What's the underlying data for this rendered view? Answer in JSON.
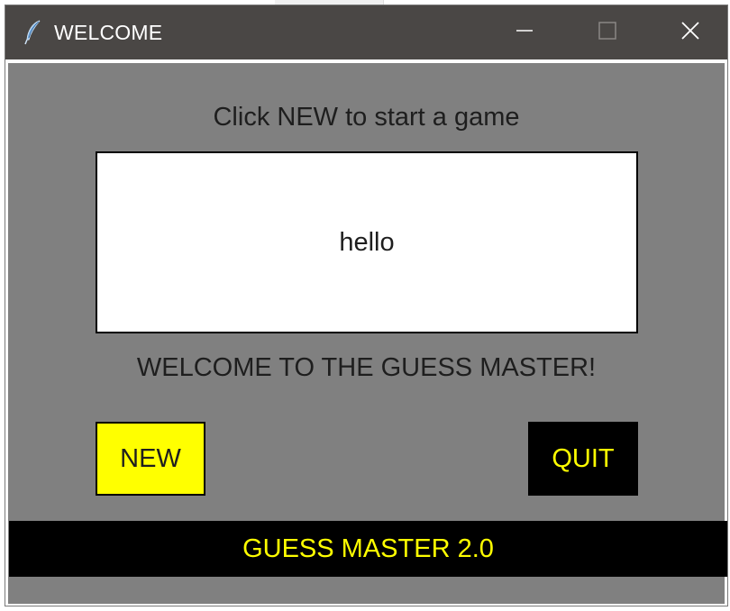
{
  "window": {
    "title": "WELCOME",
    "icon": "feather-icon",
    "controls": {
      "minimize_icon": "minimize-icon",
      "maximize_icon": "maximize-icon",
      "close_icon": "close-icon"
    }
  },
  "content": {
    "prompt": "Click NEW to start a game",
    "display_text": "hello",
    "welcome_message": "WELCOME TO THE GUESS MASTER!",
    "new_button_label": "NEW",
    "quit_button_label": "QUIT",
    "footer": "GUESS MASTER 2.0"
  },
  "colors": {
    "titlebar": "#4a4745",
    "client_background": "#808080",
    "new_button": "#ffff00",
    "quit_button": "#000000",
    "accent_text": "#ffff00",
    "footer_background": "#000000"
  }
}
